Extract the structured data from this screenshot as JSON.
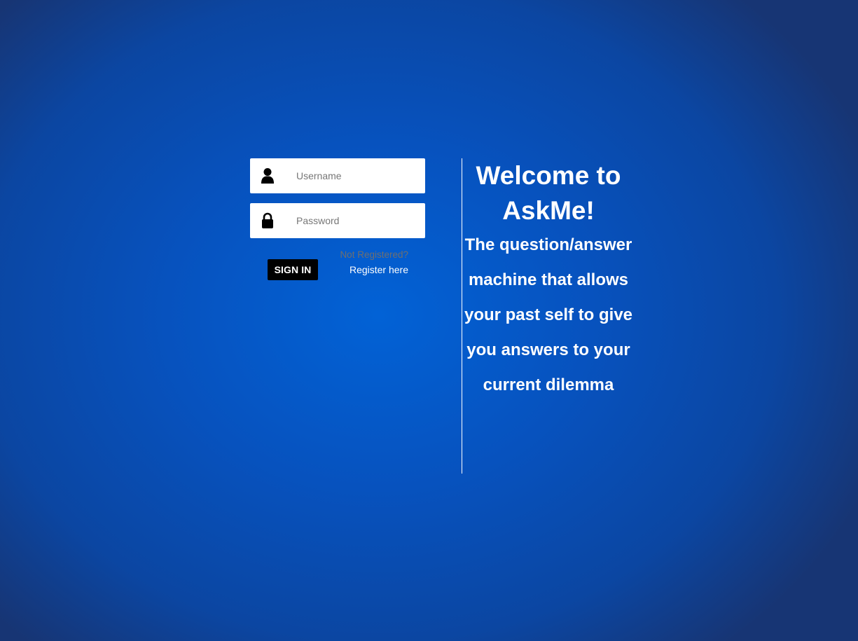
{
  "login": {
    "username": {
      "placeholder": "Username",
      "value": "",
      "icon": "user-icon"
    },
    "password": {
      "placeholder": "Password",
      "value": "",
      "icon": "lock-icon"
    },
    "signin_label": "SIGN IN",
    "not_registered_text": "Not Registered?",
    "register_link_text": "Register here"
  },
  "intro": {
    "title": "Welcome to AskMe!",
    "tagline": "The question/answer machine that allows your past self to give you answers to your current dilemma"
  },
  "colors": {
    "background_center": "#0262d6",
    "background_edge": "#173574",
    "button_bg": "#000000",
    "text": "#ffffff",
    "muted_text": "#6f6f6f"
  }
}
